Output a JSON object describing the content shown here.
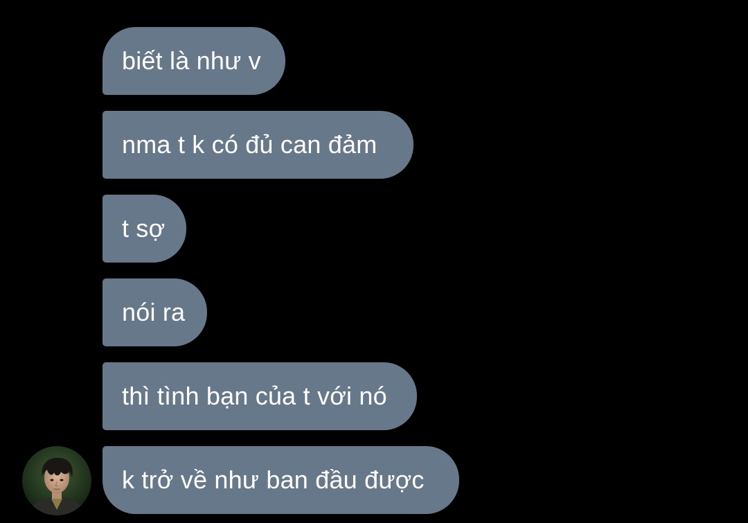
{
  "theme": {
    "background": "#000000",
    "bubble_color": "#67788a",
    "text_color": "#ffffff"
  },
  "conversation": {
    "messages": [
      {
        "text": "biết là như v"
      },
      {
        "text": "nma t k có đủ can đảm"
      },
      {
        "text": "t sợ"
      },
      {
        "text": "nói ra"
      },
      {
        "text": "thì tình bạn của t với nó"
      },
      {
        "text": "k trở về như ban đầu được"
      }
    ],
    "sender_avatar_icon": "profile-photo-young-man"
  }
}
